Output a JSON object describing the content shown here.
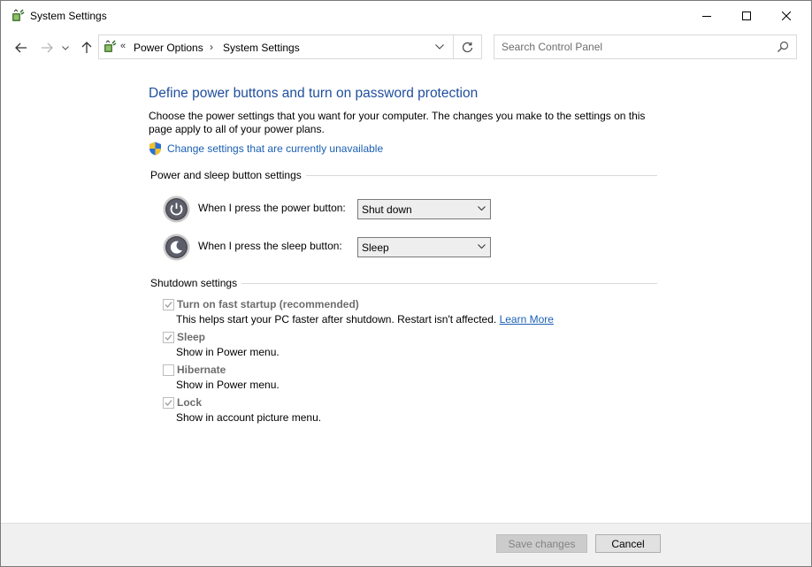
{
  "window": {
    "title": "System Settings"
  },
  "nav": {
    "breadcrumb_prefix": "«",
    "breadcrumbs": [
      "Power Options",
      "System Settings"
    ],
    "crumb_separator": "›",
    "search_placeholder": "Search Control Panel",
    "search_value": ""
  },
  "page": {
    "title": "Define power buttons and turn on password protection",
    "description": "Choose the power settings that you want for your computer. The changes you make to the settings on this page apply to all of your power plans.",
    "change_settings_link": "Change settings that are currently unavailable"
  },
  "power_section": {
    "heading": "Power and sleep button settings",
    "power_button_label": "When I press the power button:",
    "power_button_value": "Shut down",
    "sleep_button_label": "When I press the sleep button:",
    "sleep_button_value": "Sleep"
  },
  "shutdown_section": {
    "heading": "Shutdown settings",
    "items": [
      {
        "label": "Turn on fast startup (recommended)",
        "description": "This helps start your PC faster after shutdown. Restart isn't affected.",
        "link": "Learn More",
        "checked": true
      },
      {
        "label": "Sleep",
        "description": "Show in Power menu.",
        "checked": true
      },
      {
        "label": "Hibernate",
        "description": "Show in Power menu.",
        "checked": false
      },
      {
        "label": "Lock",
        "description": "Show in account picture menu.",
        "checked": true
      }
    ]
  },
  "footer": {
    "save_label": "Save changes",
    "cancel_label": "Cancel"
  },
  "colors": {
    "title_blue": "#1f4e9c",
    "link_blue": "#1a5fb4",
    "disabled_gray": "#6d6d6d",
    "footer_bg": "#f0f0f0"
  },
  "icons": {
    "app": "power-options-icon",
    "shield": "uac-shield-icon",
    "power": "power-button-icon",
    "sleep": "sleep-button-icon"
  }
}
